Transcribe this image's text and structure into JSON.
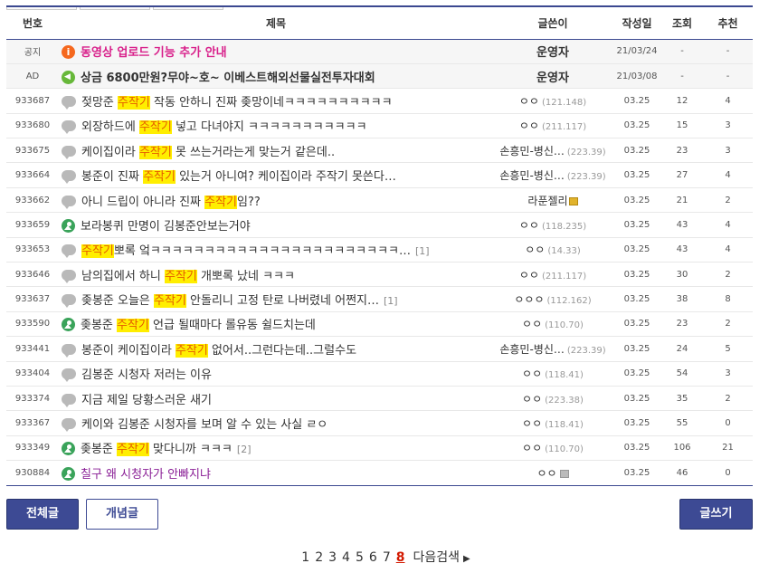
{
  "headers": {
    "num": "번호",
    "title": "제목",
    "writer": "글쓴이",
    "date": "작성일",
    "view": "조회",
    "rec": "추천"
  },
  "rows": [
    {
      "num": "공지",
      "icon": "notice-icon",
      "pre": "동영상 업로드 기능 추가 안내",
      "hl": "",
      "post": "",
      "cmt": "",
      "writer": "운영자",
      "ip": "",
      "date": "21/03/24",
      "view": "-",
      "rec": "-",
      "type": "notice"
    },
    {
      "num": "AD",
      "icon": "speaker-icon",
      "pre": "상금 6800만원?무야~호~ 이베스트해외선물실전투자대회",
      "hl": "",
      "post": "",
      "cmt": "",
      "writer": "운영자",
      "ip": "",
      "date": "21/03/08",
      "view": "-",
      "rec": "-",
      "type": "ad"
    },
    {
      "num": "933687",
      "icon": "comment-icon",
      "pre": "젖망준 ",
      "hl": "주작기",
      "post": " 작동 안하니 진짜 좆망이네ㅋㅋㅋㅋㅋㅋㅋㅋㅋㅋ",
      "cmt": "",
      "writer": "ㅇㅇ",
      "ip": "(121.148)",
      "date": "03.25",
      "view": "12",
      "rec": "4",
      "type": "normal"
    },
    {
      "num": "933680",
      "icon": "comment-icon",
      "pre": "외장하드에 ",
      "hl": "주작기",
      "post": " 넣고 다녀야지 ㅋㅋㅋㅋㅋㅋㅋㅋㅋㅋㅋ",
      "cmt": "",
      "writer": "ㅇㅇ",
      "ip": "(211.117)",
      "date": "03.25",
      "view": "15",
      "rec": "3",
      "type": "normal"
    },
    {
      "num": "933675",
      "icon": "comment-icon",
      "pre": "케이집이라 ",
      "hl": "주작기",
      "post": " 못 쓰는거라는게 맞는거 같은데..",
      "cmt": "",
      "writer": "손흥민-병신…",
      "ip": "(223.39)",
      "date": "03.25",
      "view": "23",
      "rec": "3",
      "type": "normal"
    },
    {
      "num": "933664",
      "icon": "comment-icon",
      "pre": "봉준이 진짜 ",
      "hl": "주작기",
      "post": " 있는거 아니여? 케이집이라 주작기 못쓴다…",
      "cmt": "",
      "writer": "손흥민-병신…",
      "ip": "(223.39)",
      "date": "03.25",
      "view": "27",
      "rec": "4",
      "type": "normal"
    },
    {
      "num": "933662",
      "icon": "comment-icon",
      "pre": "아니 드립이 아니라 진짜 ",
      "hl": "주작기",
      "post": "임??",
      "cmt": "",
      "writer": "라푼젤리",
      "ip": "",
      "badge": "lock",
      "date": "03.25",
      "view": "21",
      "rec": "2",
      "type": "normal"
    },
    {
      "num": "933659",
      "icon": "best-icon",
      "pre": "보라봉퀴 만명이 김봉준안보는거야",
      "hl": "",
      "post": "",
      "cmt": "",
      "writer": "ㅇㅇ",
      "ip": "(118.235)",
      "date": "03.25",
      "view": "43",
      "rec": "4",
      "type": "normal"
    },
    {
      "num": "933653",
      "icon": "comment-icon",
      "pre": "",
      "hl": "주작기",
      "post": "뽀록 엌ㅋㅋㅋㅋㅋㅋㅋㅋㅋㅋㅋㅋㅋㅋㅋㅋㅋㅋㅋㅋㅋㅋㅋ…",
      "cmt": "[1]",
      "writer": "ㅇㅇ",
      "ip": "(14.33)",
      "date": "03.25",
      "view": "43",
      "rec": "4",
      "type": "normal"
    },
    {
      "num": "933646",
      "icon": "comment-icon",
      "pre": "남의집에서 하니 ",
      "hl": "주작기",
      "post": " 개뽀록 났네 ㅋㅋㅋ",
      "cmt": "",
      "writer": "ㅇㅇ",
      "ip": "(211.117)",
      "date": "03.25",
      "view": "30",
      "rec": "2",
      "type": "normal"
    },
    {
      "num": "933637",
      "icon": "comment-icon",
      "pre": "좆봉준 오늘은 ",
      "hl": "주작기",
      "post": " 안돌리니 고정 탄로 나버렸네 어쩐지…",
      "cmt": "[1]",
      "writer": "ㅇㅇㅇ",
      "ip": "(112.162)",
      "date": "03.25",
      "view": "38",
      "rec": "8",
      "type": "normal"
    },
    {
      "num": "933590",
      "icon": "best-icon",
      "pre": "좆봉준 ",
      "hl": "주작기",
      "post": " 언급 될때마다 롤유동 쉴드치는데",
      "cmt": "",
      "writer": "ㅇㅇ",
      "ip": "(110.70)",
      "date": "03.25",
      "view": "23",
      "rec": "2",
      "type": "normal"
    },
    {
      "num": "933441",
      "icon": "comment-icon",
      "pre": "봉준이 케이집이라 ",
      "hl": "주작기",
      "post": " 없어서..그런다는데..그럴수도",
      "cmt": "",
      "writer": "손흥민-병신…",
      "ip": "(223.39)",
      "date": "03.25",
      "view": "24",
      "rec": "5",
      "type": "normal"
    },
    {
      "num": "933404",
      "icon": "comment-icon",
      "pre": "김봉준 시청자 저러는 이유",
      "hl": "",
      "post": "",
      "cmt": "",
      "writer": "ㅇㅇ",
      "ip": "(118.41)",
      "date": "03.25",
      "view": "54",
      "rec": "3",
      "type": "normal"
    },
    {
      "num": "933374",
      "icon": "comment-icon",
      "pre": "지금 제일 당황스러운 새기",
      "hl": "",
      "post": "",
      "cmt": "",
      "writer": "ㅇㅇ",
      "ip": "(223.38)",
      "date": "03.25",
      "view": "35",
      "rec": "2",
      "type": "normal"
    },
    {
      "num": "933367",
      "icon": "comment-icon",
      "pre": "케이와 김봉준 시청자를 보며 알 수 있는 사실 ㄹㅇ",
      "hl": "",
      "post": "",
      "cmt": "",
      "writer": "ㅇㅇ",
      "ip": "(118.41)",
      "date": "03.25",
      "view": "55",
      "rec": "0",
      "type": "normal"
    },
    {
      "num": "933349",
      "icon": "best-icon",
      "pre": "좆봉준 ",
      "hl": "주작기",
      "post": " 맞다니까 ㅋㅋㅋ",
      "cmt": "[2]",
      "writer": "ㅇㅇ",
      "ip": "(110.70)",
      "date": "03.25",
      "view": "106",
      "rec": "21",
      "type": "normal"
    },
    {
      "num": "930884",
      "icon": "best-icon",
      "pre": "칠구 왜 시청자가 안빠지냐",
      "hl": "",
      "post": "",
      "cmt": "",
      "writer": "ㅇㅇ",
      "ip": "",
      "badge": "gray",
      "date": "03.25",
      "view": "46",
      "rec": "0",
      "type": "link"
    }
  ],
  "buttons": {
    "all": "전체글",
    "concept": "개념글",
    "write": "글쓰기"
  },
  "paging": {
    "pages": [
      "1",
      "2",
      "3",
      "4",
      "5",
      "6",
      "7",
      "8"
    ],
    "current": "8",
    "next": "다음검색"
  },
  "colors": {
    "accent": "#3d4a94",
    "highlight": "#ffee00",
    "notice": "#d81f8a",
    "current_page": "#d31900"
  }
}
